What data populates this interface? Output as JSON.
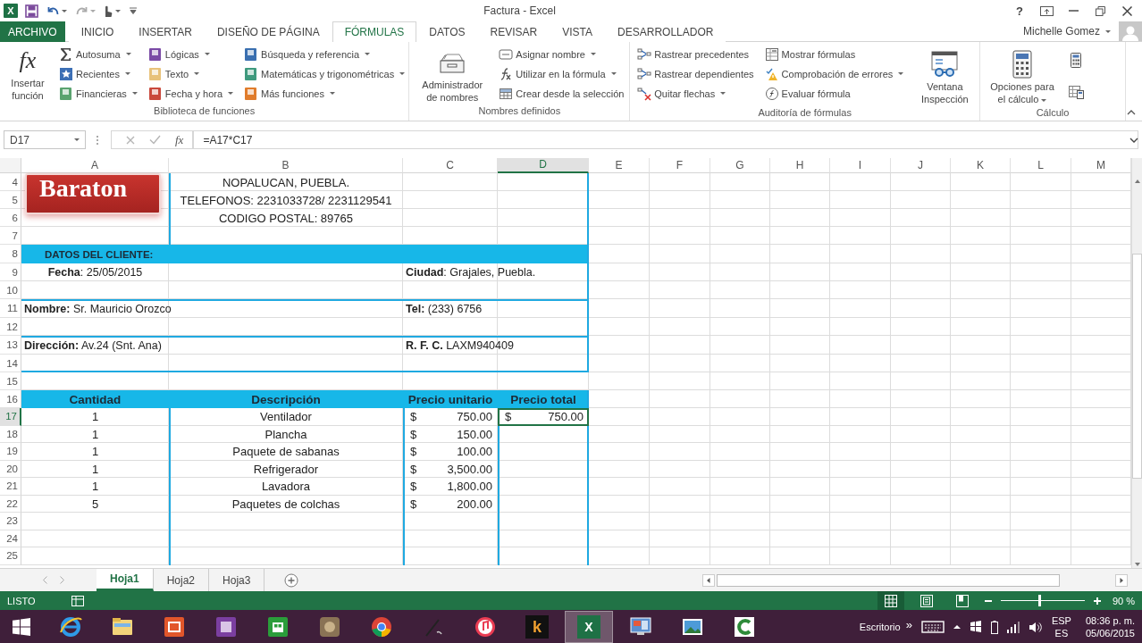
{
  "title_bar": {
    "app_glyph": "X",
    "title": "Factura - Excel",
    "help": "?"
  },
  "tabs": [
    {
      "label": "ARCHIVO",
      "kind": "file",
      "selected": false
    },
    {
      "label": "INICIO",
      "kind": "tab",
      "selected": false
    },
    {
      "label": "INSERTAR",
      "kind": "tab",
      "selected": false
    },
    {
      "label": "DISEÑO DE PÁGINA",
      "kind": "tab",
      "selected": false
    },
    {
      "label": "FÓRMULAS",
      "kind": "tab",
      "selected": true
    },
    {
      "label": "DATOS",
      "kind": "tab",
      "selected": false
    },
    {
      "label": "REVISAR",
      "kind": "tab",
      "selected": false
    },
    {
      "label": "VISTA",
      "kind": "tab",
      "selected": false
    },
    {
      "label": "DESARROLLADOR",
      "kind": "tab",
      "selected": false
    }
  ],
  "account": {
    "user": "Michelle Gomez"
  },
  "ribbon": {
    "groups": [
      {
        "label": "Biblioteca de funciones",
        "parts": [
          {
            "kind": "large",
            "label": "Insertar función",
            "glyph": "fx",
            "dropdown": false
          },
          {
            "kind": "column",
            "items": [
              {
                "label": "Autosuma",
                "dropdown": true
              },
              {
                "label": "Recientes",
                "dropdown": true
              },
              {
                "label": "Financieras",
                "dropdown": true
              }
            ]
          },
          {
            "kind": "column",
            "items": [
              {
                "label": "Lógicas",
                "dropdown": true
              },
              {
                "label": "Texto",
                "dropdown": true
              },
              {
                "label": "Fecha y hora",
                "dropdown": true
              }
            ]
          },
          {
            "kind": "column",
            "items": [
              {
                "label": "Búsqueda y referencia",
                "dropdown": true
              },
              {
                "label": "Matemáticas y trigonométricas",
                "dropdown": true
              },
              {
                "label": "Más funciones",
                "dropdown": true
              }
            ]
          }
        ]
      },
      {
        "label": "Nombres definidos",
        "parts": [
          {
            "kind": "large",
            "label": "Administrador de nombres",
            "dropdown": false
          },
          {
            "kind": "column",
            "items": [
              {
                "label": "Asignar nombre",
                "dropdown": true
              },
              {
                "label": "Utilizar en la fórmula",
                "dropdown": true
              },
              {
                "label": "Crear desde la selección",
                "dropdown": false
              }
            ]
          }
        ]
      },
      {
        "label": "Auditoría de fórmulas",
        "parts": [
          {
            "kind": "column",
            "items": [
              {
                "label": "Rastrear precedentes",
                "dropdown": false
              },
              {
                "label": "Rastrear dependientes",
                "dropdown": false
              },
              {
                "label": "Quitar flechas",
                "dropdown": true
              }
            ]
          },
          {
            "kind": "column",
            "items": [
              {
                "label": "Mostrar fórmulas",
                "dropdown": false
              },
              {
                "label": "Comprobación de errores",
                "dropdown": true
              },
              {
                "label": "Evaluar fórmula",
                "dropdown": false
              }
            ]
          },
          {
            "kind": "large",
            "label": "Ventana Inspección",
            "dropdown": false
          }
        ]
      },
      {
        "label": "Cálculo",
        "parts": [
          {
            "kind": "large",
            "label": "Opciones para el cálculo",
            "dropdown": true
          },
          {
            "kind": "icons"
          }
        ]
      }
    ]
  },
  "formula_bar": {
    "name_box": "D17",
    "fx": "fx",
    "formula": "=A17*C17"
  },
  "sheet": {
    "logo": {
      "text": "Baraton"
    },
    "columns": [
      {
        "label": "A",
        "selected": false
      },
      {
        "label": "B",
        "selected": false
      },
      {
        "label": "C",
        "selected": false
      },
      {
        "label": "D",
        "selected": true
      },
      {
        "label": "E",
        "selected": false
      },
      {
        "label": "F",
        "selected": false
      },
      {
        "label": "G",
        "selected": false
      },
      {
        "label": "H",
        "selected": false
      },
      {
        "label": "I",
        "selected": false
      },
      {
        "label": "J",
        "selected": false
      },
      {
        "label": "K",
        "selected": false
      },
      {
        "label": "L",
        "selected": false
      },
      {
        "label": "M",
        "selected": false
      }
    ],
    "rows": [
      {
        "number": "4",
        "kind": "letterhead",
        "selected": false,
        "cells": {
          "B": {
            "text": "NOPALUCAN, PUEBLA.",
            "selected": false
          }
        }
      },
      {
        "number": "5",
        "kind": "letterhead",
        "selected": false,
        "cells": {
          "B": {
            "text": "TELEFONOS: 2231033728/ 2231129541",
            "selected": false
          }
        }
      },
      {
        "number": "6",
        "kind": "letterhead",
        "selected": false,
        "cells": {
          "B": {
            "text": "CODIGO POSTAL: 89765",
            "selected": false
          }
        }
      },
      {
        "number": "7",
        "kind": "letterhead",
        "selected": false
      },
      {
        "number": "8",
        "kind": "band",
        "selected": false,
        "cells": {
          "A": {
            "text": "DATOS DEL CLIENTE:",
            "selected": false
          }
        }
      },
      {
        "number": "9",
        "kind": "form",
        "selected": false,
        "cells": {
          "A": {
            "text": "**Fecha**: 25/05/2015",
            "selected": false
          },
          "C": {
            "text": "**Ciudad**: Grajales, Puebla.",
            "selected": false
          }
        }
      },
      {
        "number": "10",
        "kind": "form",
        "selected": false
      },
      {
        "number": "11",
        "kind": "form-rule",
        "selected": false,
        "cells": {
          "A": {
            "text": "**Nombre:** Sr. Mauricio Orozco",
            "selected": false
          },
          "C": {
            "text": "**Tel:** (233) 6756",
            "selected": false
          }
        }
      },
      {
        "number": "12",
        "kind": "form",
        "selected": false
      },
      {
        "number": "13",
        "kind": "form-rule",
        "selected": false,
        "cells": {
          "A": {
            "text": "**Dirección:** Av.24 (Snt. Ana)",
            "selected": false
          },
          "C": {
            "text": "**R. F. C.** LAXM940409",
            "selected": false
          }
        }
      },
      {
        "number": "14",
        "kind": "form-end",
        "selected": false
      },
      {
        "number": "15",
        "kind": "blank",
        "selected": false
      },
      {
        "number": "16",
        "kind": "table-head",
        "selected": false,
        "cells": {
          "A": {
            "text": "Cantidad",
            "selected": false
          },
          "B": {
            "text": "Descripción",
            "selected": false
          },
          "C": {
            "text": "Precio unitario",
            "selected": false
          },
          "D": {
            "text": "Precio total",
            "selected": false
          }
        }
      },
      {
        "number": "17",
        "kind": "table",
        "selected": true,
        "cells": {
          "A": {
            "text": "1",
            "selected": false
          },
          "B": {
            "text": "Ventilador",
            "selected": false
          },
          "C": {
            "currency": "$",
            "text": "750.00",
            "selected": false
          },
          "D": {
            "currency": "$",
            "text": "750.00",
            "selected": true
          }
        }
      },
      {
        "number": "18",
        "kind": "table",
        "selected": false,
        "cells": {
          "A": {
            "text": "1",
            "selected": false
          },
          "B": {
            "text": "Plancha",
            "selected": false
          },
          "C": {
            "currency": "$",
            "text": "150.00",
            "selected": false
          }
        }
      },
      {
        "number": "19",
        "kind": "table",
        "selected": false,
        "cells": {
          "A": {
            "text": "1",
            "selected": false
          },
          "B": {
            "text": "Paquete de sabanas",
            "selected": false
          },
          "C": {
            "currency": "$",
            "text": "100.00",
            "selected": false
          }
        }
      },
      {
        "number": "20",
        "kind": "table",
        "selected": false,
        "cells": {
          "A": {
            "text": "1",
            "selected": false
          },
          "B": {
            "text": "Refrigerador",
            "selected": false
          },
          "C": {
            "currency": "$",
            "text": "3,500.00",
            "selected": false
          }
        }
      },
      {
        "number": "21",
        "kind": "table",
        "selected": false,
        "cells": {
          "A": {
            "text": "1",
            "selected": false
          },
          "B": {
            "text": "Lavadora",
            "selected": false
          },
          "C": {
            "currency": "$",
            "text": "1,800.00",
            "selected": false
          }
        }
      },
      {
        "number": "22",
        "kind": "table",
        "selected": false,
        "cells": {
          "A": {
            "text": "5",
            "selected": false
          },
          "B": {
            "text": "Paquetes de colchas",
            "selected": false
          },
          "C": {
            "currency": "$",
            "text": "200.00",
            "selected": false
          }
        }
      },
      {
        "number": "23",
        "kind": "table",
        "selected": false
      },
      {
        "number": "24",
        "kind": "table",
        "selected": false
      },
      {
        "number": "25",
        "kind": "table",
        "selected": false
      }
    ]
  },
  "sheet_tabs": [
    {
      "label": "Hoja1",
      "selected": true
    },
    {
      "label": "Hoja2",
      "selected": false
    },
    {
      "label": "Hoja3",
      "selected": false
    }
  ],
  "status_bar": {
    "mode": "LISTO",
    "views": [
      {
        "kind": "normal",
        "selected": true
      },
      {
        "kind": "layout",
        "selected": false
      },
      {
        "kind": "break",
        "selected": false
      }
    ],
    "zoom": {
      "level": 0.46,
      "reading": "90 %"
    }
  },
  "taskbar": {
    "apps": [
      {
        "kind": "browser",
        "active": false
      },
      {
        "kind": "folder",
        "active": false
      },
      {
        "kind": "photos",
        "active": false
      },
      {
        "kind": "media",
        "active": false
      },
      {
        "kind": "store",
        "active": false
      },
      {
        "kind": "game",
        "active": false
      },
      {
        "kind": "chrome",
        "active": false
      },
      {
        "kind": "pen",
        "active": false
      },
      {
        "kind": "music",
        "active": false
      },
      {
        "kind": "letter",
        "glyph": "k",
        "active": false
      },
      {
        "kind": "excel",
        "glyph": "X",
        "active": true
      },
      {
        "kind": "remote",
        "active": false
      },
      {
        "kind": "image",
        "active": false
      },
      {
        "kind": "recorder",
        "active": false
      }
    ],
    "desktop": "Escritorio",
    "more": "»",
    "language": "ESP",
    "layout": "ES",
    "time": "08:36 p. m.",
    "date": "05/06/2015"
  }
}
